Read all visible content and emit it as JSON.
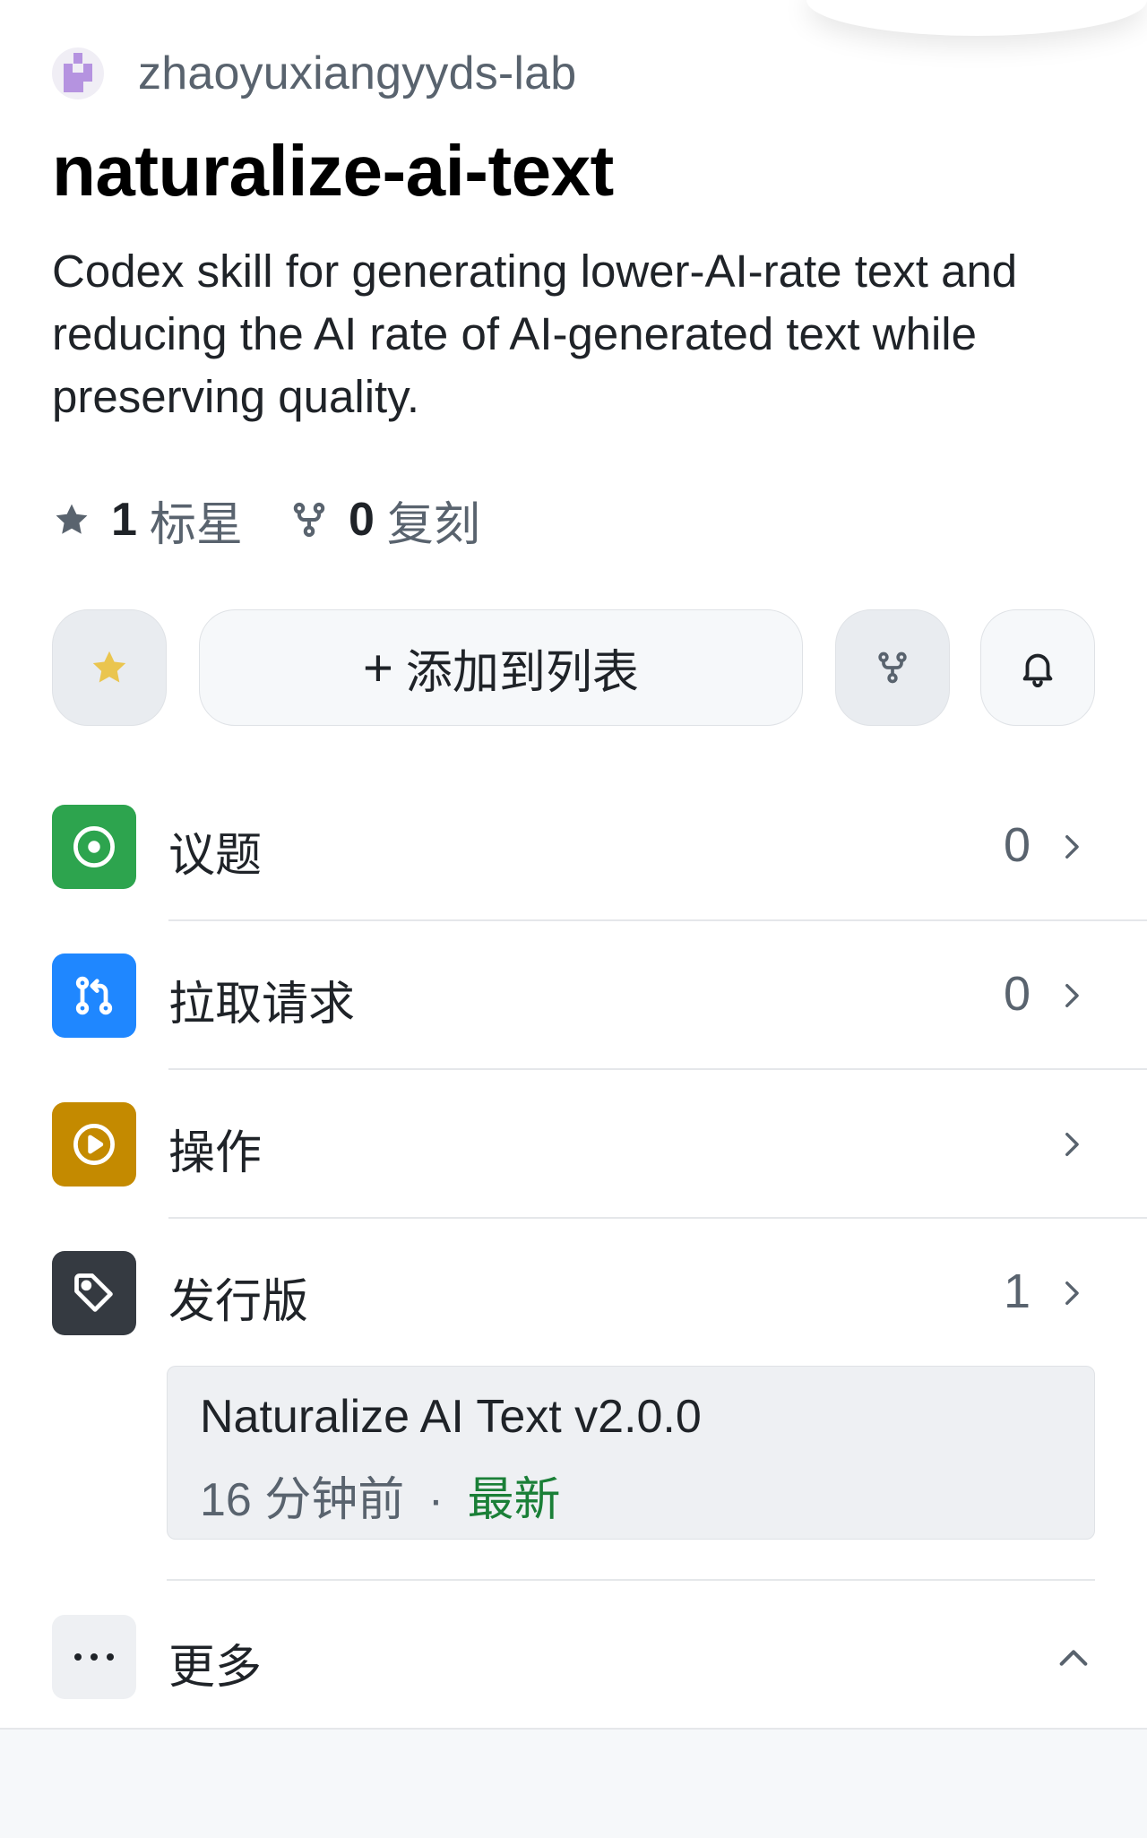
{
  "owner": {
    "name": "zhaoyuxiangyyds-lab",
    "avatar_icon": "identicon"
  },
  "repo": {
    "name": "naturalize-ai-text",
    "description": "Codex skill for generating lower-AI-rate text and reducing the AI rate of AI-generated text while preserving quality."
  },
  "stats": {
    "stars": {
      "count": "1",
      "label": "标星",
      "icon": "star-icon"
    },
    "forks": {
      "count": "0",
      "label": "复刻",
      "icon": "fork-icon"
    }
  },
  "actions": {
    "star_icon": "star-filled-icon",
    "add_to_list_plus": "+",
    "add_to_list_label": "添加到列表",
    "fork_icon": "fork-icon",
    "watch_icon": "bell-icon"
  },
  "menu": {
    "issues": {
      "label": "议题",
      "count": "0",
      "icon": "issue-opened-icon",
      "color": "#2da44e"
    },
    "pulls": {
      "label": "拉取请求",
      "count": "0",
      "icon": "git-pull-request-icon",
      "color": "#1f87ff"
    },
    "actions": {
      "label": "操作",
      "count": "",
      "icon": "play-icon",
      "color": "#c48a00"
    },
    "releases": {
      "label": "发行版",
      "count": "1",
      "icon": "tag-icon",
      "color": "#353a41"
    }
  },
  "latest_release": {
    "name": "Naturalize AI Text v2.0.0",
    "time": "16 分钟前",
    "separator": "·",
    "badge": "最新",
    "badge_color": "#1a7f37"
  },
  "more": {
    "label": "更多",
    "icon": "kebab-horizontal-icon"
  }
}
